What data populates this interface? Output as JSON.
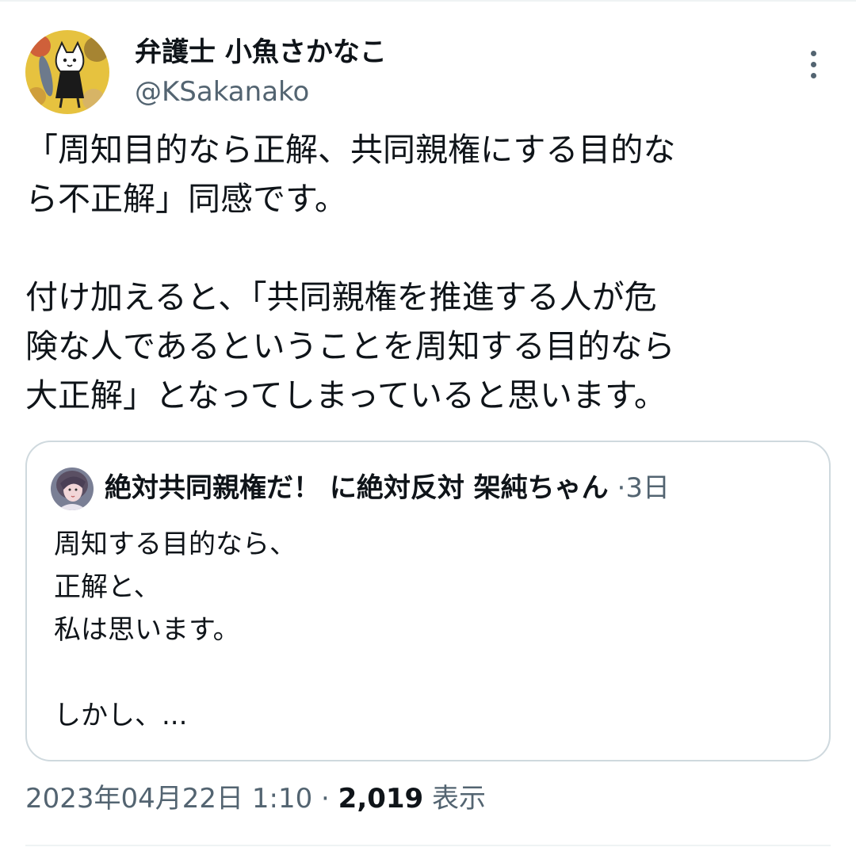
{
  "author": {
    "display_name": "弁護士 小魚さかなこ",
    "handle": "@KSakanako",
    "avatar_icon": "cat-with-fish-avatar-icon"
  },
  "tweet": {
    "lines": [
      "「周知目的なら正解、共同親権にする目的な",
      "ら不正解」同感です。",
      "",
      "付け加えると、「共同親権を推進する人が危",
      "険な人であるということを周知する目的なら",
      "大正解」となってしまっていると思います。"
    ]
  },
  "quote": {
    "author_name": "絶対共同親権だ！ に絶対反対 架純ちゃん",
    "separator": "·",
    "time": "3日",
    "avatar_icon": "portrait-avatar-icon",
    "lines": [
      "周知する目的なら、",
      "正解と、",
      "私は思います。",
      "",
      "しかし、..."
    ]
  },
  "meta": {
    "timestamp": "2023年04月22日 1:10",
    "separator": "·",
    "views_count": "2,019",
    "views_label": "表示"
  },
  "colors": {
    "text_primary": "#0f1419",
    "text_secondary": "#536471",
    "border": "#cfd9de"
  }
}
